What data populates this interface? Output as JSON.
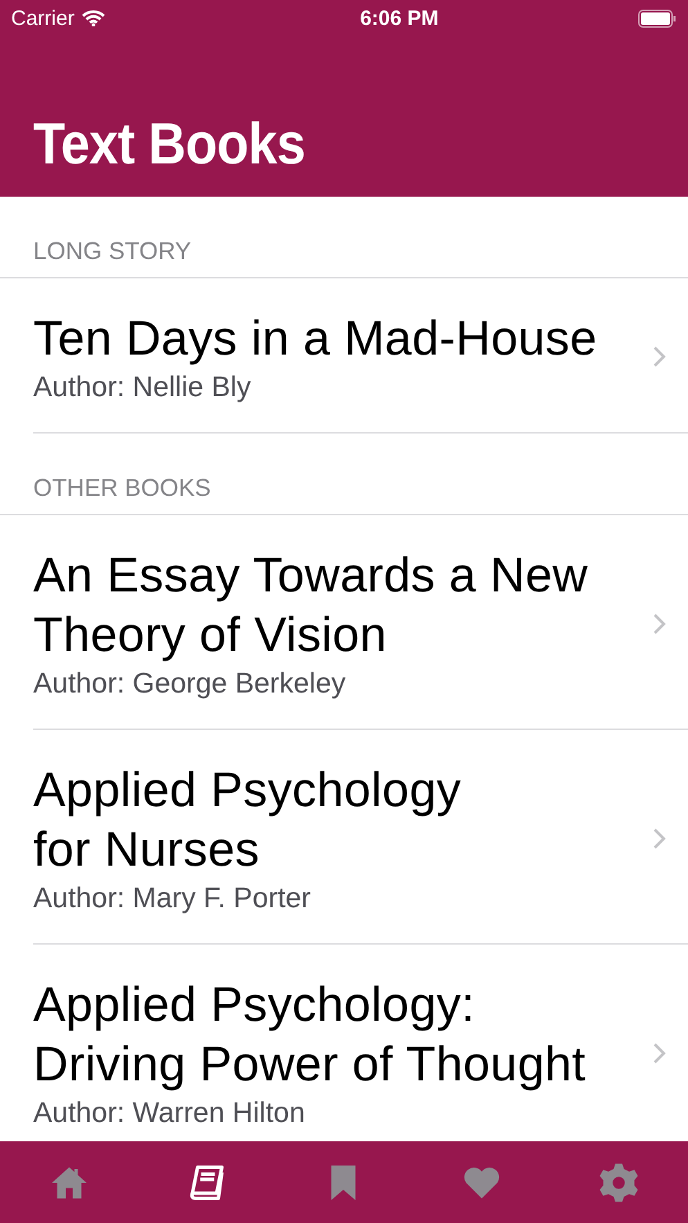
{
  "status_bar": {
    "carrier": "Carrier",
    "time": "6:06 PM"
  },
  "title": "Text Books",
  "sections": [
    {
      "header": "LONG STORY",
      "books": [
        {
          "title": "Ten Days in a Mad-House",
          "author": "Author: Nellie Bly"
        }
      ]
    },
    {
      "header": "OTHER BOOKS",
      "books": [
        {
          "title": "An Essay Towards a New\nTheory of Vision",
          "author": "Author: George Berkeley"
        },
        {
          "title": "Applied Psychology\nfor Nurses",
          "author": "Author: Mary F. Porter"
        },
        {
          "title": "Applied Psychology:\nDriving Power of Thought",
          "author": "Author: Warren Hilton"
        }
      ]
    }
  ],
  "tabs": [
    {
      "kind": "home",
      "selected": false
    },
    {
      "kind": "book",
      "selected": true
    },
    {
      "kind": "bookmark",
      "selected": false
    },
    {
      "kind": "heart",
      "selected": false
    },
    {
      "kind": "settings",
      "selected": false
    }
  ]
}
